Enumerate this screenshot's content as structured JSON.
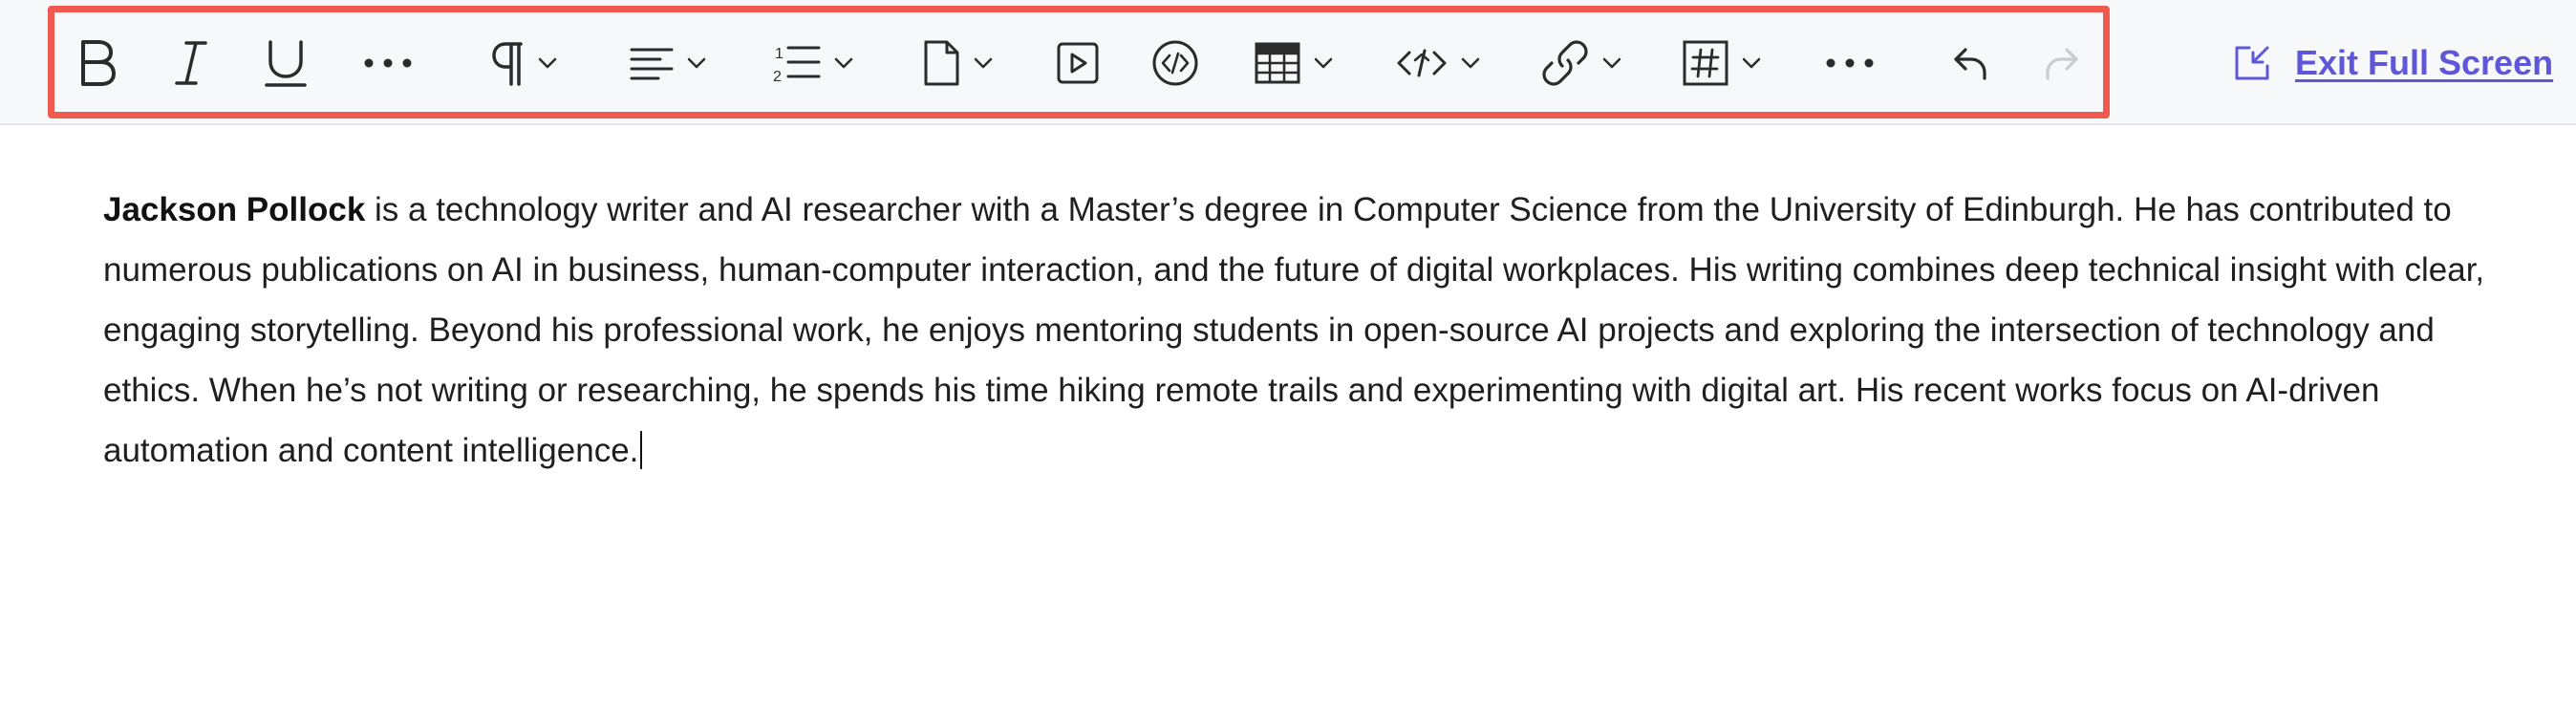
{
  "toolbar": {
    "buttons": [
      {
        "name": "bold",
        "icon": "bold-icon"
      },
      {
        "name": "italic",
        "icon": "italic-icon"
      },
      {
        "name": "underline",
        "icon": "underline-icon"
      },
      {
        "name": "more-text",
        "icon": "more-horizontal-icon"
      },
      {
        "name": "paragraph-format",
        "icon": "pilcrow-icon"
      },
      {
        "name": "align",
        "icon": "align-left-icon"
      },
      {
        "name": "ordered-list",
        "icon": "ordered-list-icon"
      },
      {
        "name": "insert-file",
        "icon": "file-icon"
      },
      {
        "name": "insert-video",
        "icon": "video-icon"
      },
      {
        "name": "insert-embed",
        "icon": "embed-code-icon"
      },
      {
        "name": "insert-table",
        "icon": "table-icon"
      },
      {
        "name": "code-view",
        "icon": "code-tag-icon"
      },
      {
        "name": "insert-link",
        "icon": "link-icon"
      },
      {
        "name": "insert-hashtag",
        "icon": "hashtag-icon"
      },
      {
        "name": "more-rich",
        "icon": "more-horizontal-icon"
      },
      {
        "name": "undo",
        "icon": "undo-icon"
      },
      {
        "name": "redo",
        "icon": "redo-icon"
      }
    ],
    "colors": {
      "highlight_border": "#f0594f",
      "icon": "#2b2b2b",
      "icon_disabled": "#c9ccd1",
      "link": "#5f57d8"
    }
  },
  "exit_fullscreen": {
    "label": "Exit Full Screen",
    "icon": "exit-fullscreen-icon"
  },
  "editor": {
    "author_name": "Jackson Pollock",
    "body": " is a technology writer and AI researcher with a Master’s degree in Computer Science from the University of Edinburgh. He has contributed to numerous publications on AI in business, human-computer interaction, and the future of digital workplaces. His writing combines deep technical insight with clear, engaging storytelling. Beyond his professional work, he enjoys mentoring students in open-source AI projects and exploring the intersection of technology and ethics. When he’s not writing or researching, he spends his time hiking remote trails and experimenting with digital art. His recent works focus on AI-driven automation and content intelligence."
  }
}
